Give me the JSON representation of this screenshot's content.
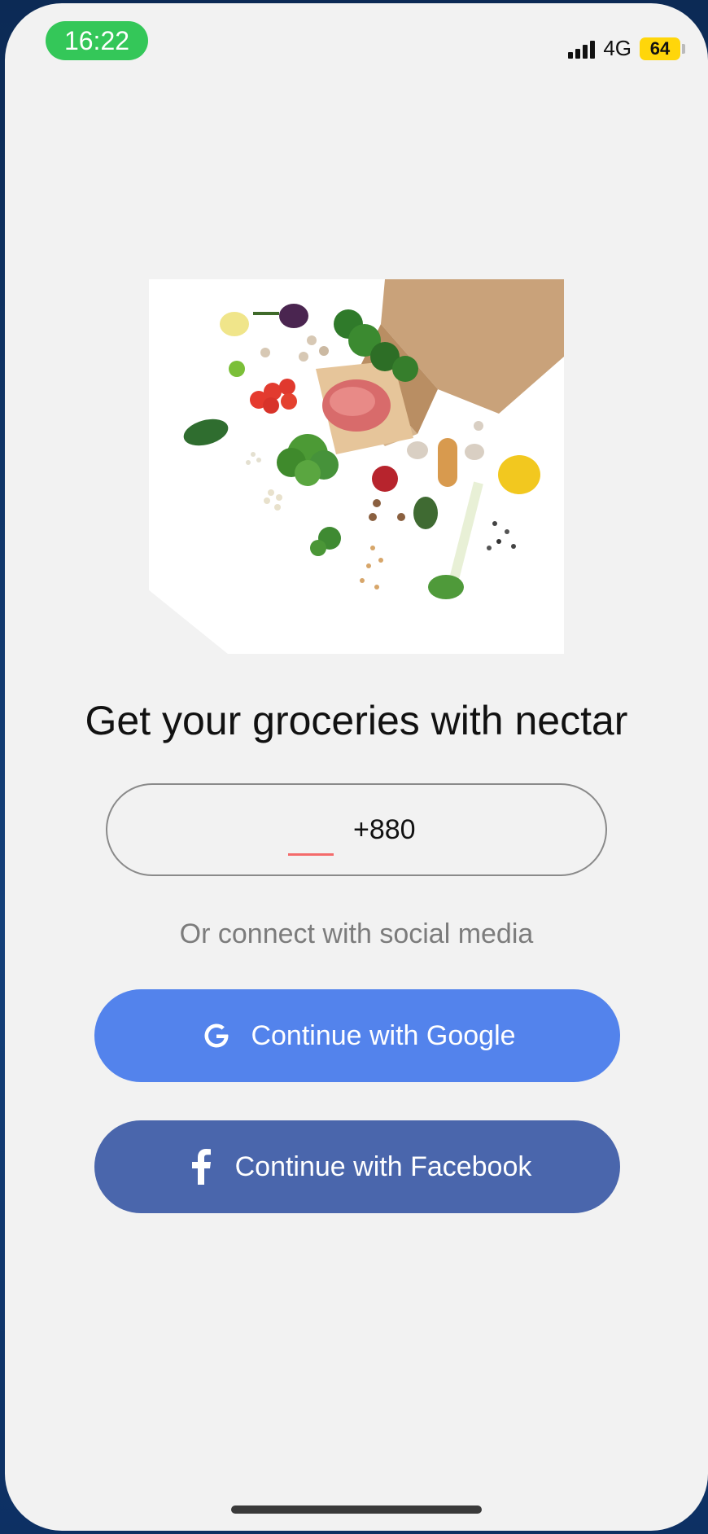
{
  "status_bar": {
    "time": "16:22",
    "network": "4G",
    "battery": "64"
  },
  "hero": {
    "icon": "groceries-illustration"
  },
  "title": "Get your groceries with nectar",
  "phone_input": {
    "country_code": "+880"
  },
  "divider_text": "Or connect with social media",
  "buttons": {
    "google": {
      "label": "Continue with Google",
      "icon": "google-icon",
      "color": "#5383ec"
    },
    "facebook": {
      "label": "Continue with Facebook",
      "icon": "facebook-icon",
      "color": "#4a66ac"
    }
  },
  "colors": {
    "status_pill": "#34c759",
    "battery": "#ffd60a",
    "input_cursor": "#f46b6b",
    "background": "#f2f2f2"
  }
}
